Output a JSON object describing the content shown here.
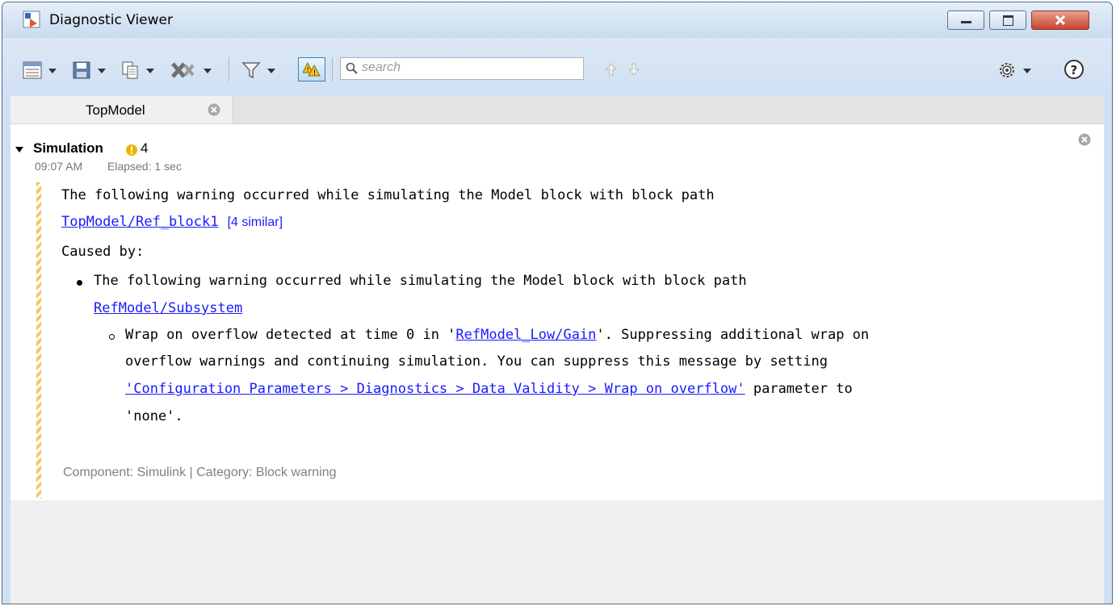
{
  "window": {
    "title": "Diagnostic Viewer"
  },
  "toolbar": {
    "search_placeholder": "search"
  },
  "tabs": [
    {
      "label": "TopModel"
    }
  ],
  "section": {
    "title": "Simulation",
    "warning_count": "4",
    "time": "09:07 AM",
    "elapsed": "Elapsed: 1 sec"
  },
  "message": {
    "line1": "The following warning occurred while simulating the Model block with block path",
    "link1": "TopModel/Ref_block1",
    "similar": "[4 similar]",
    "caused_by": "Caused by:",
    "bullet1_text": "The following warning occurred while simulating the Model block with block path",
    "bullet1_link": "RefModel/Subsystem",
    "sub_pre": "Wrap on overflow detected at time 0 in '",
    "sub_link": "RefModel_Low/Gain",
    "sub_post": "'. Suppressing additional wrap on",
    "sub_line2": "overflow warnings and continuing simulation. You can suppress this message by setting",
    "sub_link2": "'Configuration Parameters > Diagnostics > Data Validity > Wrap on overflow'",
    "sub_line3_post": " parameter to",
    "sub_line4": "'none'.",
    "component": "Component: Simulink | Category: Block warning"
  },
  "colors": {
    "link": "#1a1aff",
    "warning": "#f0b400",
    "close_button": "#c8452c"
  }
}
